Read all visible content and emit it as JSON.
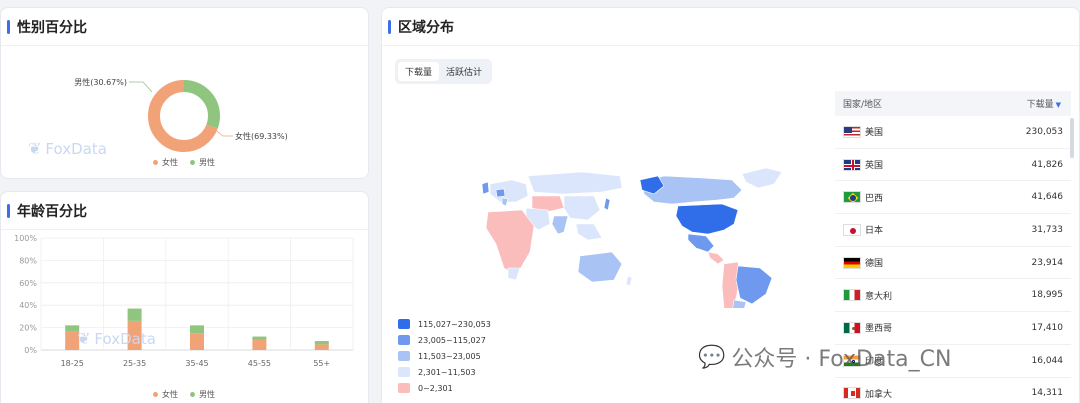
{
  "gender": {
    "title": "性别百分比",
    "male_label": "男性(30.67%)",
    "female_label": "女性(69.33%)",
    "male_pct": 30.67,
    "female_pct": 69.33,
    "legend_female": "女性",
    "legend_male": "男性",
    "female_color": "#f2a277",
    "male_color": "#8fc57f",
    "watermark": "FoxData"
  },
  "age": {
    "title": "年龄百分比",
    "watermark": "FoxData",
    "legend_female": "女性",
    "legend_male": "男性"
  },
  "chart_data": {
    "type": "bar",
    "stacked": true,
    "categories": [
      "18-25",
      "25-35",
      "35-45",
      "45-55",
      "55+"
    ],
    "series": [
      {
        "name": "女性",
        "values": [
          17,
          26,
          15,
          9,
          5
        ],
        "color": "#f2a277"
      },
      {
        "name": "男性",
        "values": [
          5,
          11,
          7,
          3,
          3
        ],
        "color": "#8fc57f"
      }
    ],
    "y_ticks": [
      "0%",
      "20%",
      "40%",
      "60%",
      "80%",
      "100%"
    ],
    "ylim": [
      0,
      100
    ],
    "grid": true,
    "legend_position": "bottom"
  },
  "region": {
    "title": "区域分布",
    "tabs": [
      "下载量",
      "活跃估计"
    ],
    "active_tab": 0,
    "map_legend": [
      {
        "label": "115,027~230,053",
        "color": "#2f6ee8"
      },
      {
        "label": "23,005~115,027",
        "color": "#6f99ee"
      },
      {
        "label": "11,503~23,005",
        "color": "#a9c3f4"
      },
      {
        "label": "2,301~11,503",
        "color": "#dbe5fb"
      },
      {
        "label": "0~2,301",
        "color": "#fbbcbc"
      }
    ],
    "table": {
      "col_country": "国家/地区",
      "col_downloads": "下载量",
      "sort_icon": "sort-desc-icon",
      "rows": [
        {
          "country": "美国",
          "value": "230,053",
          "flag": "us"
        },
        {
          "country": "英国",
          "value": "41,826",
          "flag": "gb"
        },
        {
          "country": "巴西",
          "value": "41,646",
          "flag": "br"
        },
        {
          "country": "日本",
          "value": "31,733",
          "flag": "jp"
        },
        {
          "country": "德国",
          "value": "23,914",
          "flag": "de"
        },
        {
          "country": "意大利",
          "value": "18,995",
          "flag": "it"
        },
        {
          "country": "墨西哥",
          "value": "17,410",
          "flag": "mx"
        },
        {
          "country": "印度",
          "value": "16,044",
          "flag": "in"
        },
        {
          "country": "加拿大",
          "value": "14,311",
          "flag": "ca"
        }
      ]
    }
  },
  "overlay_watermark": "公众号 · FoxData_CN"
}
